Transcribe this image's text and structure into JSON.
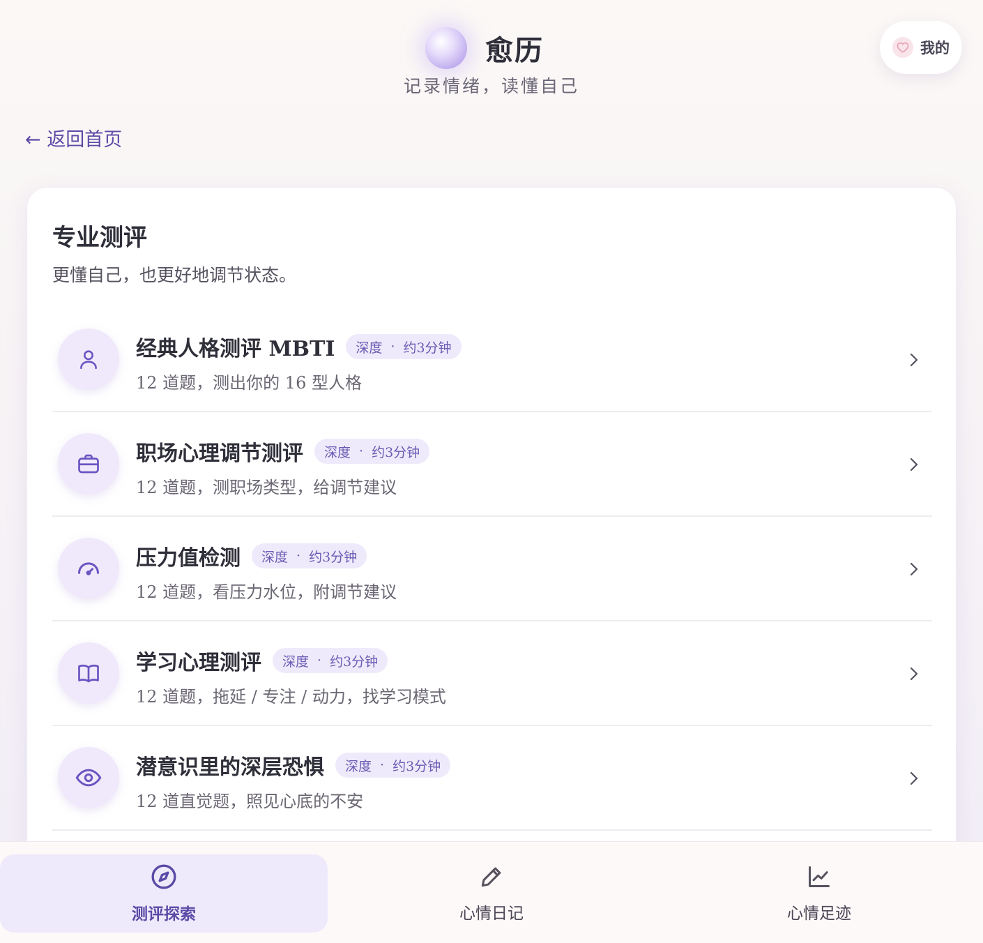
{
  "header": {
    "app_name": "愈历",
    "tagline": "记录情绪，读懂自己",
    "mine_label": "我的"
  },
  "back_link": "← 返回首页",
  "section": {
    "title": "专业测评",
    "subtitle": "更懂自己，也更好地调节状态。"
  },
  "tests": [
    {
      "icon": "user-icon",
      "title": "经典人格测评 MBTI",
      "badge_depth": "深度",
      "badge_dot": "·",
      "badge_time": "约3分钟",
      "desc": "12 道题，测出你的 16 型人格"
    },
    {
      "icon": "briefcase-icon",
      "title": "职场心理调节测评",
      "badge_depth": "深度",
      "badge_dot": "·",
      "badge_time": "约3分钟",
      "desc": "12 道题，测职场类型，给调节建议"
    },
    {
      "icon": "gauge-icon",
      "title": "压力值检测",
      "badge_depth": "深度",
      "badge_dot": "·",
      "badge_time": "约3分钟",
      "desc": "12 道题，看压力水位，附调节建议"
    },
    {
      "icon": "book-icon",
      "title": "学习心理测评",
      "badge_depth": "深度",
      "badge_dot": "·",
      "badge_time": "约3分钟",
      "desc": "12 道题，拖延 / 专注 / 动力，找学习模式"
    },
    {
      "icon": "eye-icon",
      "title": "潜意识里的深层恐惧",
      "badge_depth": "深度",
      "badge_dot": "·",
      "badge_time": "约3分钟",
      "desc": "12 道直觉题，照见心底的不安"
    }
  ],
  "bottom_nav": [
    {
      "icon": "compass-icon",
      "label": "测评探索",
      "active": true
    },
    {
      "icon": "pencil-icon",
      "label": "心情日记",
      "active": false
    },
    {
      "icon": "chart-icon",
      "label": "心情足迹",
      "active": false
    }
  ],
  "colors": {
    "accent": "#5b4aa6",
    "badge_bg": "#efeafb",
    "icon_bg": "#efe9fb"
  }
}
